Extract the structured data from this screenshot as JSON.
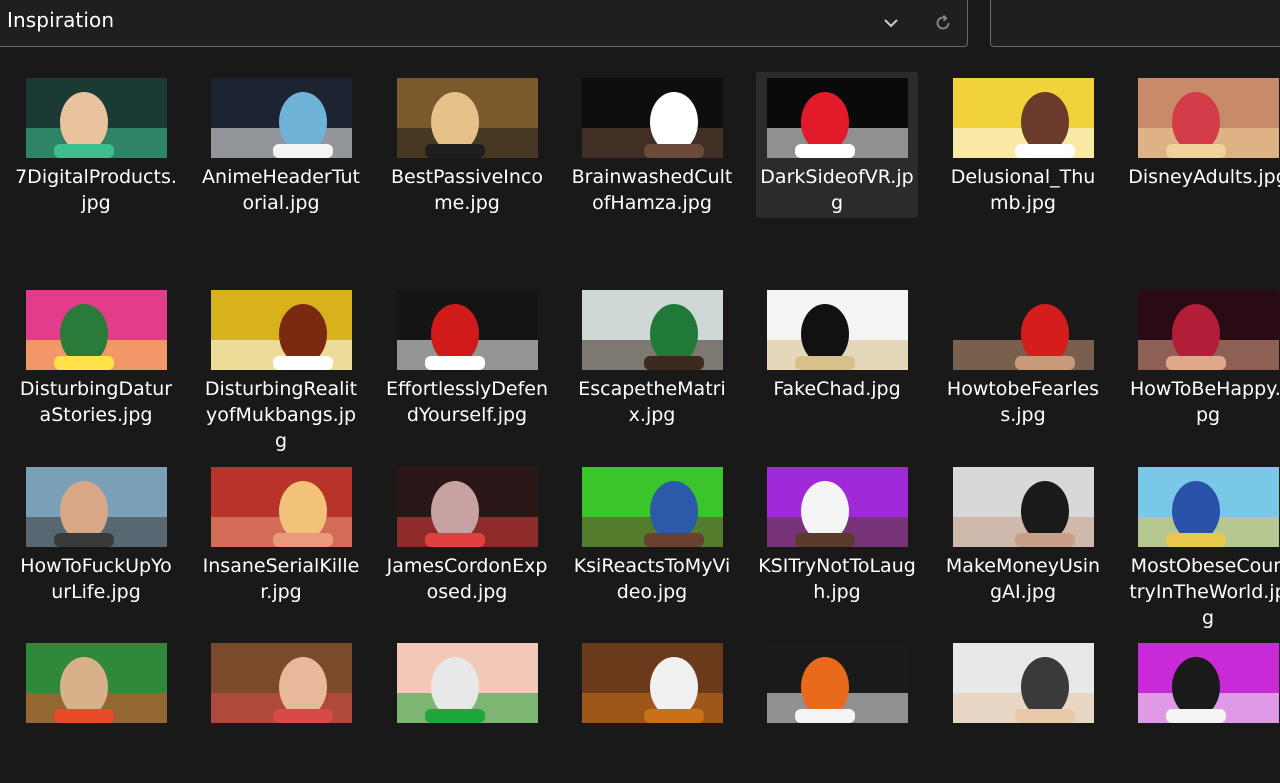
{
  "address_bar": {
    "path": "Inspiration",
    "dropdown_icon": "chevron-down-icon",
    "refresh_icon": "refresh-icon"
  },
  "colors": {
    "background": "#191919",
    "selected_tile": "#2b2b2b",
    "border": "#6a6a6a"
  },
  "files": [
    {
      "name": "7DigitalProducts.jpg",
      "selected": false,
      "palette": [
        "#1b3a34",
        "#e8c39e",
        "#3fbf8f"
      ]
    },
    {
      "name": "AnimeHeaderTutorial.jpg",
      "selected": false,
      "palette": [
        "#1b2430",
        "#6fb3d9",
        "#f4f4f4"
      ]
    },
    {
      "name": "BestPassiveIncome.jpg",
      "selected": false,
      "palette": [
        "#7a5a2a",
        "#e6c28a",
        "#1e1e1e"
      ]
    },
    {
      "name": "BrainwashedCultofHamza.jpg",
      "selected": false,
      "palette": [
        "#0e0e0e",
        "#ffffff",
        "#6b4a3a"
      ]
    },
    {
      "name": "DarkSideofVR.jpg",
      "selected": true,
      "palette": [
        "#0a0a0a",
        "#e21b2b",
        "#ffffff"
      ]
    },
    {
      "name": "Delusional_Thumb.jpg",
      "selected": false,
      "palette": [
        "#f2d23b",
        "#6a3b2a",
        "#ffffff"
      ]
    },
    {
      "name": "DisneyAdults.jpg",
      "selected": false,
      "palette": [
        "#c78b6a",
        "#d43c4a",
        "#f0d39a"
      ]
    },
    {
      "name": "DisturbingDaturaStories.jpg",
      "selected": false,
      "palette": [
        "#e23d8a",
        "#2a7a3a",
        "#ffe14a"
      ]
    },
    {
      "name": "DisturbingRealityofMukbangs.jpg",
      "selected": false,
      "palette": [
        "#d8b21c",
        "#7a2a10",
        "#ffffff"
      ]
    },
    {
      "name": "EffortlesslyDefendYourself.jpg",
      "selected": false,
      "palette": [
        "#141414",
        "#d11a1a",
        "#ffffff"
      ]
    },
    {
      "name": "EscapetheMatrix.jpg",
      "selected": false,
      "palette": [
        "#cfd8d6",
        "#1f7a3a",
        "#3a2a20"
      ]
    },
    {
      "name": "FakeChad.jpg",
      "selected": false,
      "palette": [
        "#f4f4f4",
        "#111111",
        "#d8c08a"
      ]
    },
    {
      "name": "HowtobeFearless.jpg",
      "selected": false,
      "palette": [
        "#1a1a1a",
        "#d61d1d",
        "#c89a7a"
      ]
    },
    {
      "name": "HowToBeHappy.jpg",
      "selected": false,
      "palette": [
        "#2a0a14",
        "#b21d38",
        "#e0a88a"
      ]
    },
    {
      "name": "HowToFuckUpYourLife.jpg",
      "selected": false,
      "palette": [
        "#7aa0b8",
        "#d8a886",
        "#3a3a3a"
      ]
    },
    {
      "name": "InsaneSerialKiller.jpg",
      "selected": false,
      "palette": [
        "#b8342a",
        "#f2c27a",
        "#e89a7a"
      ]
    },
    {
      "name": "JamesCordonExposed.jpg",
      "selected": false,
      "palette": [
        "#2a1616",
        "#c8a2a2",
        "#e04040"
      ]
    },
    {
      "name": "KsiReactsToMyVideo.jpg",
      "selected": false,
      "palette": [
        "#3ac62a",
        "#2a5aa8",
        "#6a4030"
      ]
    },
    {
      "name": "KSITryNotToLaugh.jpg",
      "selected": false,
      "palette": [
        "#a02ad8",
        "#f4f4f4",
        "#5a3a2a"
      ]
    },
    {
      "name": "MakeMoneyUsingAI.jpg",
      "selected": false,
      "palette": [
        "#d8d8d8",
        "#1a1a1a",
        "#c8a08a"
      ]
    },
    {
      "name": "MostObeseCountryInTheWorld.jpg",
      "selected": false,
      "palette": [
        "#7ac8e8",
        "#2a52a8",
        "#e8c84a"
      ]
    },
    {
      "name": "",
      "selected": false,
      "palette": [
        "#2e8a3a",
        "#d8b08a",
        "#e84a2a"
      ]
    },
    {
      "name": "",
      "selected": false,
      "palette": [
        "#7a4a2a",
        "#e8b89a",
        "#d84a4a"
      ]
    },
    {
      "name": "",
      "selected": false,
      "palette": [
        "#f2c8b8",
        "#e8e8e8",
        "#1ea83a"
      ]
    },
    {
      "name": "",
      "selected": false,
      "palette": [
        "#6a3a1a",
        "#f0f0f0",
        "#c8701a"
      ]
    },
    {
      "name": "",
      "selected": false,
      "palette": [
        "#1a1a1a",
        "#e86a1a",
        "#f4f4f4"
      ]
    },
    {
      "name": "",
      "selected": false,
      "palette": [
        "#e8e8e8",
        "#3a3a3a",
        "#e8c8a8"
      ]
    },
    {
      "name": "",
      "selected": false,
      "palette": [
        "#c82ad8",
        "#1a1a1a",
        "#f4f4f4"
      ]
    }
  ]
}
